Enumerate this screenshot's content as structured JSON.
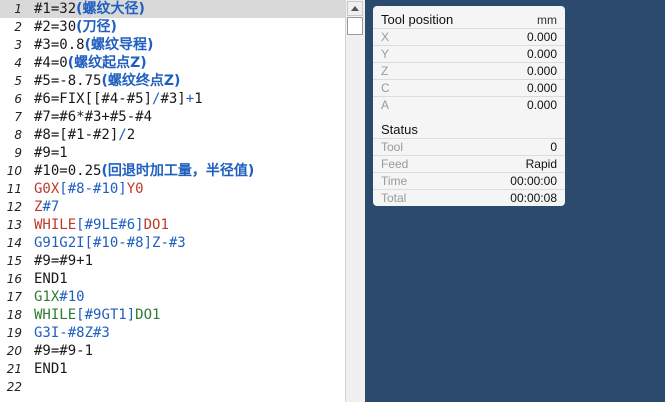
{
  "editor": {
    "lines": [
      {
        "n": "1",
        "parts": [
          {
            "t": "#1=32",
            "c": "c-black"
          },
          {
            "t": "(螺纹大径)",
            "c": "cmt"
          }
        ]
      },
      {
        "n": "2",
        "parts": [
          {
            "t": "#2=30",
            "c": "c-black"
          },
          {
            "t": "(刀径)",
            "c": "cmt"
          }
        ]
      },
      {
        "n": "3",
        "parts": [
          {
            "t": "#3=0.8",
            "c": "c-black"
          },
          {
            "t": "(螺纹导程)",
            "c": "cmt"
          }
        ]
      },
      {
        "n": "4",
        "parts": [
          {
            "t": "#4=0",
            "c": "c-black"
          },
          {
            "t": "(螺纹起点Z)",
            "c": "cmt"
          }
        ]
      },
      {
        "n": "5",
        "parts": [
          {
            "t": "#5=-8.75",
            "c": "c-black"
          },
          {
            "t": "(螺纹终点Z)",
            "c": "cmt"
          }
        ]
      },
      {
        "n": "6",
        "parts": [
          {
            "t": "#6=FIX[[#4-#5]",
            "c": "c-black"
          },
          {
            "t": "/",
            "c": "c-op"
          },
          {
            "t": "#3]",
            "c": "c-black"
          },
          {
            "t": "+",
            "c": "c-op"
          },
          {
            "t": "1",
            "c": "c-black"
          }
        ]
      },
      {
        "n": "7",
        "parts": [
          {
            "t": "#7=#6*#3+#5-#4",
            "c": "c-black"
          }
        ]
      },
      {
        "n": "8",
        "parts": [
          {
            "t": "#8=[#1-#2]",
            "c": "c-black"
          },
          {
            "t": "/",
            "c": "c-op"
          },
          {
            "t": "2",
            "c": "c-black"
          }
        ]
      },
      {
        "n": "9",
        "parts": [
          {
            "t": "#9=1",
            "c": "c-black"
          }
        ]
      },
      {
        "n": "10",
        "parts": [
          {
            "t": "#10=0.25",
            "c": "c-black"
          },
          {
            "t": "(回退时加工量，半径值)",
            "c": "cmt"
          }
        ]
      },
      {
        "n": "11",
        "parts": [
          {
            "t": "G0X",
            "c": "c-red"
          },
          {
            "t": "[#8-#10]",
            "c": "c-blue"
          },
          {
            "t": "Y0",
            "c": "c-red"
          }
        ]
      },
      {
        "n": "12",
        "parts": [
          {
            "t": "Z",
            "c": "c-red"
          },
          {
            "t": "#7",
            "c": "c-blue"
          }
        ]
      },
      {
        "n": "13",
        "parts": [
          {
            "t": "WHILE",
            "c": "c-red"
          },
          {
            "t": "[#9LE#6]",
            "c": "c-blue"
          },
          {
            "t": "DO1",
            "c": "c-red"
          }
        ]
      },
      {
        "n": "14",
        "parts": [
          {
            "t": "G91G2I",
            "c": "c-blue"
          },
          {
            "t": "[#10-#8]",
            "c": "c-blue"
          },
          {
            "t": "Z-#3",
            "c": "c-blue"
          }
        ]
      },
      {
        "n": "15",
        "parts": [
          {
            "t": "#9=#9+1",
            "c": "c-black"
          }
        ]
      },
      {
        "n": "16",
        "parts": [
          {
            "t": "END1",
            "c": "c-black"
          }
        ]
      },
      {
        "n": "17",
        "parts": [
          {
            "t": "G1X",
            "c": "c-green"
          },
          {
            "t": "#10",
            "c": "c-blue"
          }
        ]
      },
      {
        "n": "18",
        "parts": [
          {
            "t": "WHILE",
            "c": "c-green"
          },
          {
            "t": "[#9GT1]",
            "c": "c-blue"
          },
          {
            "t": "DO1",
            "c": "c-green"
          }
        ]
      },
      {
        "n": "19",
        "parts": [
          {
            "t": "G3I-",
            "c": "c-blue"
          },
          {
            "t": "#8",
            "c": "c-blue"
          },
          {
            "t": "Z#3",
            "c": "c-blue"
          }
        ]
      },
      {
        "n": "20",
        "parts": [
          {
            "t": "#9=#9-1",
            "c": "c-black"
          }
        ]
      },
      {
        "n": "21",
        "parts": [
          {
            "t": "END1",
            "c": "c-black"
          }
        ]
      },
      {
        "n": "22",
        "parts": []
      }
    ]
  },
  "panel": {
    "position_title": "Tool position",
    "unit": "mm",
    "axes": [
      {
        "label": "X",
        "value": "0.000"
      },
      {
        "label": "Y",
        "value": "0.000"
      },
      {
        "label": "Z",
        "value": "0.000"
      },
      {
        "label": "C",
        "value": "0.000"
      },
      {
        "label": "A",
        "value": "0.000"
      }
    ],
    "status_title": "Status",
    "status": [
      {
        "label": "Tool",
        "value": "0"
      },
      {
        "label": "Feed",
        "value": "Rapid"
      },
      {
        "label": "Time",
        "value": "00:00:00"
      },
      {
        "label": "Total",
        "value": "00:00:08"
      }
    ]
  }
}
